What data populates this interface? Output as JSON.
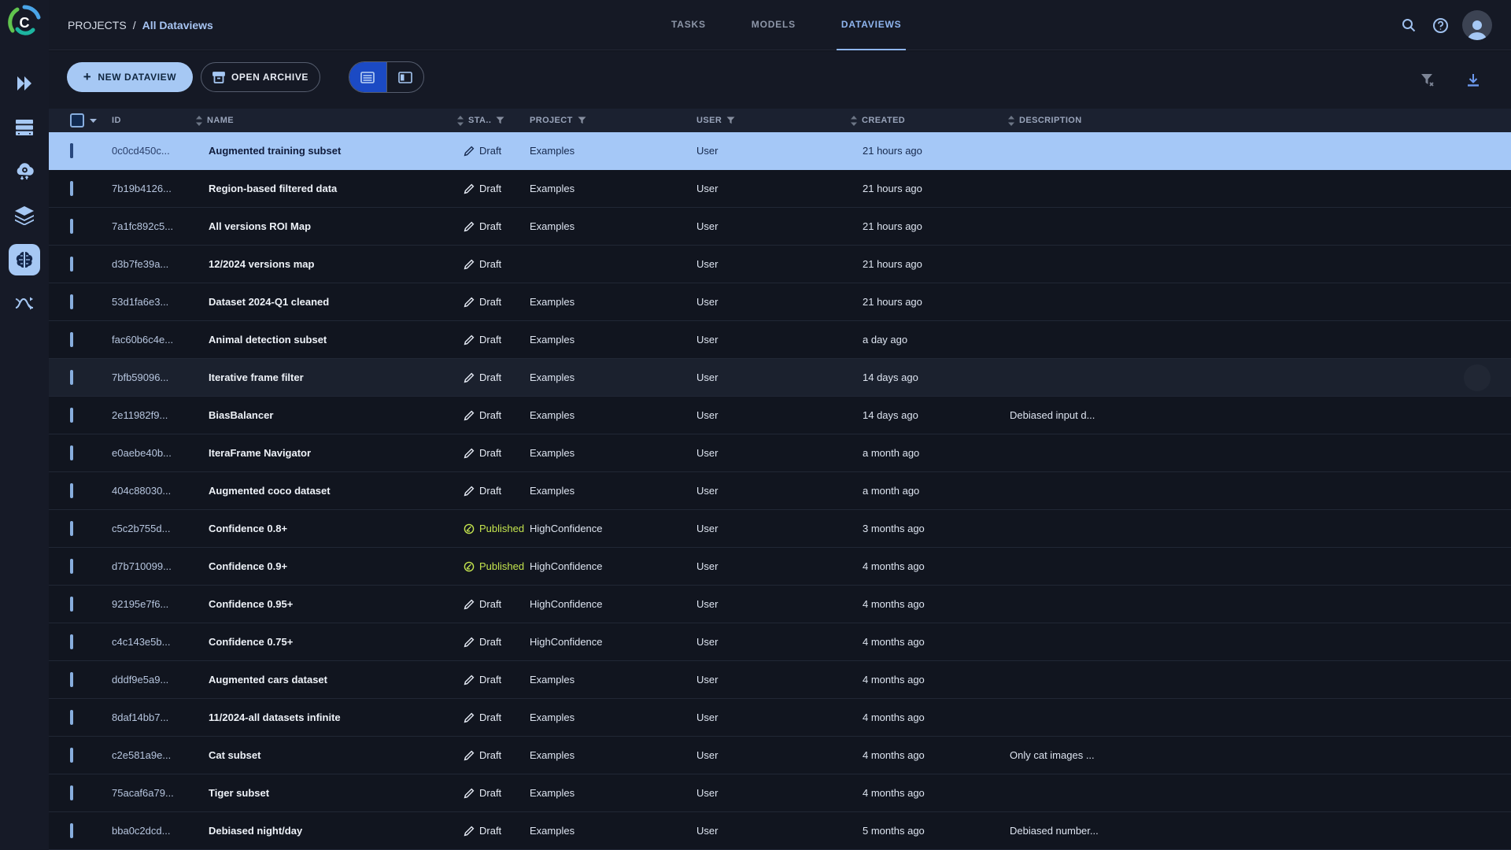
{
  "colors": {
    "accent": "#a6c8f4",
    "active_tab": "#8fb5ef",
    "selected_row": "#a5c8f7",
    "published": "#c4e44e",
    "toggle_active": "#1b4ac4",
    "topbar_bg": "#151925"
  },
  "sidebar": {
    "items": [
      {
        "icon": "expand-icon",
        "active": false
      },
      {
        "icon": "workers-queues-icon",
        "active": false
      },
      {
        "icon": "autoscalers-icon",
        "active": false
      },
      {
        "icon": "datasets-icon",
        "active": false
      },
      {
        "icon": "hyper-datasets-icon",
        "active": true
      },
      {
        "icon": "pipelines-icon",
        "active": false
      }
    ]
  },
  "topbar": {
    "breadcrumb": {
      "root": "PROJECTS",
      "separator": "/",
      "current": "All Dataviews"
    },
    "tabs": [
      {
        "label": "TASKS",
        "active": false
      },
      {
        "label": "MODELS",
        "active": false
      },
      {
        "label": "DATAVIEWS",
        "active": true
      }
    ],
    "icons": [
      "search-icon",
      "help-icon",
      "avatar"
    ]
  },
  "toolbar": {
    "new_dataview_label": "NEW DATAVIEW",
    "open_archive_label": "OPEN ARCHIVE",
    "view_modes": [
      "table-view",
      "card-view"
    ],
    "active_view": "table-view",
    "right_icons": [
      "clear-filters-icon",
      "download-icon"
    ]
  },
  "table": {
    "columns": [
      {
        "key": "id",
        "label": "ID",
        "sort": false,
        "filter": false
      },
      {
        "key": "name",
        "label": "NAME",
        "sort": true,
        "filter": false
      },
      {
        "key": "status",
        "label": "STA..",
        "sort": true,
        "filter": true
      },
      {
        "key": "project",
        "label": "PROJECT",
        "sort": false,
        "filter": true
      },
      {
        "key": "user",
        "label": "USER",
        "sort": false,
        "filter": true
      },
      {
        "key": "created",
        "label": "CREATED",
        "sort": true,
        "filter": false
      },
      {
        "key": "description",
        "label": "DESCRIPTION",
        "sort": true,
        "filter": false
      }
    ],
    "rows": [
      {
        "id": "0c0cd450c...",
        "name": "Augmented training subset",
        "status": "Draft",
        "project": "Examples",
        "user": "User",
        "created": "21 hours ago",
        "description": "",
        "selected": true,
        "hovered": false
      },
      {
        "id": "7b19b4126...",
        "name": "Region-based filtered data",
        "status": "Draft",
        "project": "Examples",
        "user": "User",
        "created": "21 hours ago",
        "description": "",
        "selected": false,
        "hovered": false
      },
      {
        "id": "7a1fc892c5...",
        "name": "All versions ROI Map",
        "status": "Draft",
        "project": "Examples",
        "user": "User",
        "created": "21 hours ago",
        "description": "",
        "selected": false,
        "hovered": false
      },
      {
        "id": "d3b7fe39a...",
        "name": "12/2024 versions map",
        "status": "Draft",
        "project": "",
        "user": "User",
        "created": "21 hours ago",
        "description": "",
        "selected": false,
        "hovered": false
      },
      {
        "id": "53d1fa6e3...",
        "name": "Dataset 2024-Q1 cleaned",
        "status": "Draft",
        "project": "Examples",
        "user": "User",
        "created": "21 hours ago",
        "description": "",
        "selected": false,
        "hovered": false
      },
      {
        "id": "fac60b6c4e...",
        "name": "Animal detection subset",
        "status": "Draft",
        "project": "Examples",
        "user": "User",
        "created": "a day ago",
        "description": "",
        "selected": false,
        "hovered": false
      },
      {
        "id": "7bfb59096...",
        "name": "Iterative frame filter",
        "status": "Draft",
        "project": "Examples",
        "user": "User",
        "created": "14 days ago",
        "description": "",
        "selected": false,
        "hovered": true
      },
      {
        "id": "2e11982f9...",
        "name": "BiasBalancer",
        "status": "Draft",
        "project": "Examples",
        "user": "User",
        "created": "14 days ago",
        "description": "Debiased input d...",
        "selected": false,
        "hovered": false
      },
      {
        "id": "e0aebe40b...",
        "name": "IteraFrame Navigator",
        "status": "Draft",
        "project": "Examples",
        "user": "User",
        "created": "a month ago",
        "description": "",
        "selected": false,
        "hovered": false
      },
      {
        "id": "404c88030...",
        "name": "Augmented coco dataset",
        "status": "Draft",
        "project": "Examples",
        "user": "User",
        "created": "a month ago",
        "description": "",
        "selected": false,
        "hovered": false
      },
      {
        "id": "c5c2b755d...",
        "name": "Confidence 0.8+",
        "status": "Published",
        "project": "HighConfidence",
        "user": "User",
        "created": "3 months ago",
        "description": "",
        "selected": false,
        "hovered": false
      },
      {
        "id": "d7b710099...",
        "name": "Confidence 0.9+",
        "status": "Published",
        "project": "HighConfidence",
        "user": "User",
        "created": "4 months ago",
        "description": "",
        "selected": false,
        "hovered": false
      },
      {
        "id": "92195e7f6...",
        "name": "Confidence 0.95+",
        "status": "Draft",
        "project": "HighConfidence",
        "user": "User",
        "created": "4 months ago",
        "description": "",
        "selected": false,
        "hovered": false
      },
      {
        "id": "c4c143e5b...",
        "name": "Confidence 0.75+",
        "status": "Draft",
        "project": "HighConfidence",
        "user": "User",
        "created": "4 months ago",
        "description": "",
        "selected": false,
        "hovered": false
      },
      {
        "id": "dddf9e5a9...",
        "name": "Augmented cars dataset",
        "status": "Draft",
        "project": "Examples",
        "user": "User",
        "created": "4 months ago",
        "description": "",
        "selected": false,
        "hovered": false
      },
      {
        "id": "8daf14bb7...",
        "name": "11/2024-all datasets infinite",
        "status": "Draft",
        "project": "Examples",
        "user": "User",
        "created": "4 months ago",
        "description": "",
        "selected": false,
        "hovered": false
      },
      {
        "id": "c2e581a9e...",
        "name": "Cat subset",
        "status": "Draft",
        "project": "Examples",
        "user": "User",
        "created": "4 months ago",
        "description": "Only cat images ...",
        "selected": false,
        "hovered": false
      },
      {
        "id": "75acaf6a79...",
        "name": "Tiger subset",
        "status": "Draft",
        "project": "Examples",
        "user": "User",
        "created": "4 months ago",
        "description": "",
        "selected": false,
        "hovered": false
      },
      {
        "id": "bba0c2dcd...",
        "name": "Debiased night/day",
        "status": "Draft",
        "project": "Examples",
        "user": "User",
        "created": "5 months ago",
        "description": "Debiased number...",
        "selected": false,
        "hovered": false
      }
    ]
  }
}
